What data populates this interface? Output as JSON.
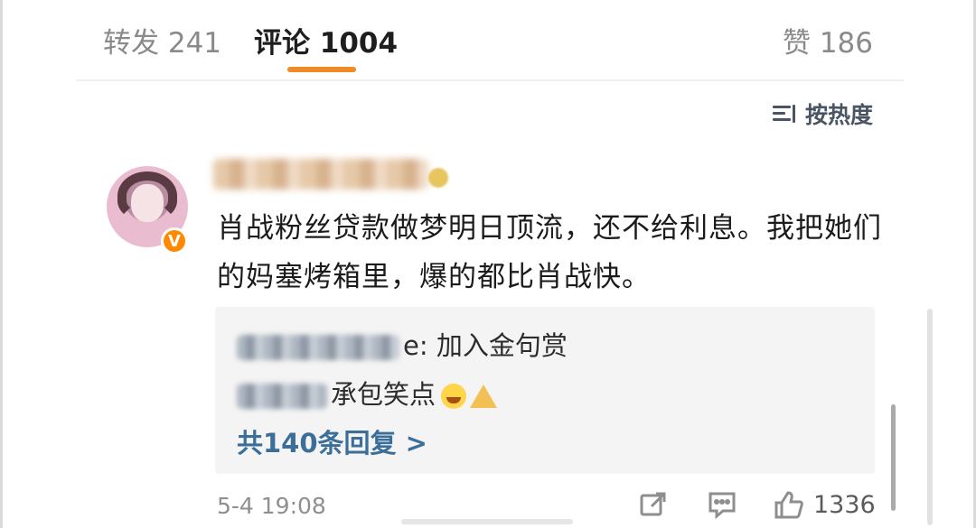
{
  "tabs": {
    "repost": "转发 241",
    "comment": "评论 1004",
    "like": "赞 186"
  },
  "sort": {
    "label": "按热度"
  },
  "comment": {
    "text": "肖战粉丝贷款做梦明日顶流，还不给利息。我把她们的妈塞烤箱里，爆的都比肖战快。",
    "time": "5-4 19:08",
    "likes": "1336"
  },
  "replies": {
    "items": [
      {
        "text": "e: 加入金句赏"
      },
      {
        "text": "承包笑点"
      }
    ],
    "more": "共140条回复 >"
  }
}
